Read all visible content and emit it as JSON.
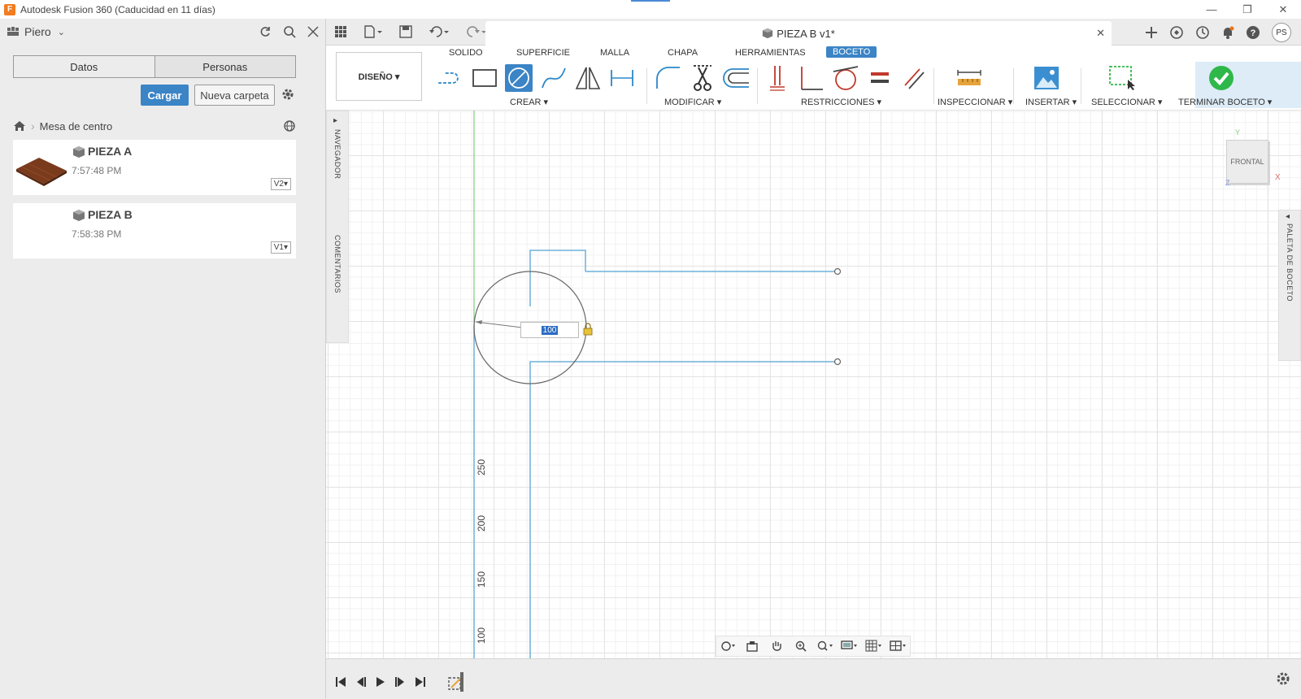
{
  "window": {
    "title": "Autodesk Fusion 360 (Caducidad en 11 días)",
    "logo_letter": "F",
    "min_glyph": "—",
    "max_glyph": "❐",
    "close_glyph": "✕"
  },
  "data_panel": {
    "user": "Piero",
    "tabs": [
      {
        "label": "Datos"
      },
      {
        "label": "Personas"
      }
    ],
    "upload_label": "Cargar",
    "new_folder_label": "Nueva carpeta",
    "breadcrumb": {
      "folder": "Mesa de centro"
    },
    "files": [
      {
        "name": "PIEZA A",
        "time": "7:57:48 PM",
        "version": "V2▾"
      },
      {
        "name": "PIEZA B",
        "time": "7:58:38 PM",
        "version": "V1▾"
      }
    ]
  },
  "document": {
    "title": "PIEZA B v1*",
    "close": "✕"
  },
  "user_initials": "PS",
  "toolbar": {
    "workspace": "DISEÑO ▾",
    "tabs": [
      "SOLIDO",
      "SUPERFICIE",
      "MALLA",
      "CHAPA",
      "HERRAMIENTAS",
      "BOCETO"
    ],
    "active_tab": "BOCETO",
    "groups": {
      "crear": "CREAR ▾",
      "modificar": "MODIFICAR ▾",
      "restricciones": "RESTRICCIONES ▾",
      "inspeccionar": "INSPECCIONAR ▾",
      "insertar": "INSERTAR ▾",
      "seleccionar": "SELECCIONAR ▾",
      "terminar": "TERMINAR BOCETO ▾"
    }
  },
  "side_panels": {
    "navigator": "NAVEGADOR",
    "comments": "COMENTARIOS",
    "palette": "PALETA DE BOCETO"
  },
  "sketch": {
    "dimension_value": "100",
    "ruler_labels": [
      "250",
      "200",
      "150",
      "100"
    ]
  },
  "viewcube": {
    "face": "FRONTAL",
    "axis_y": "Y",
    "axis_x": "X",
    "axis_z": "Z"
  },
  "colors": {
    "accent": "#3b84c6",
    "sketch_line": "#6fb0d8",
    "terminate_green": "#2fb84a"
  }
}
